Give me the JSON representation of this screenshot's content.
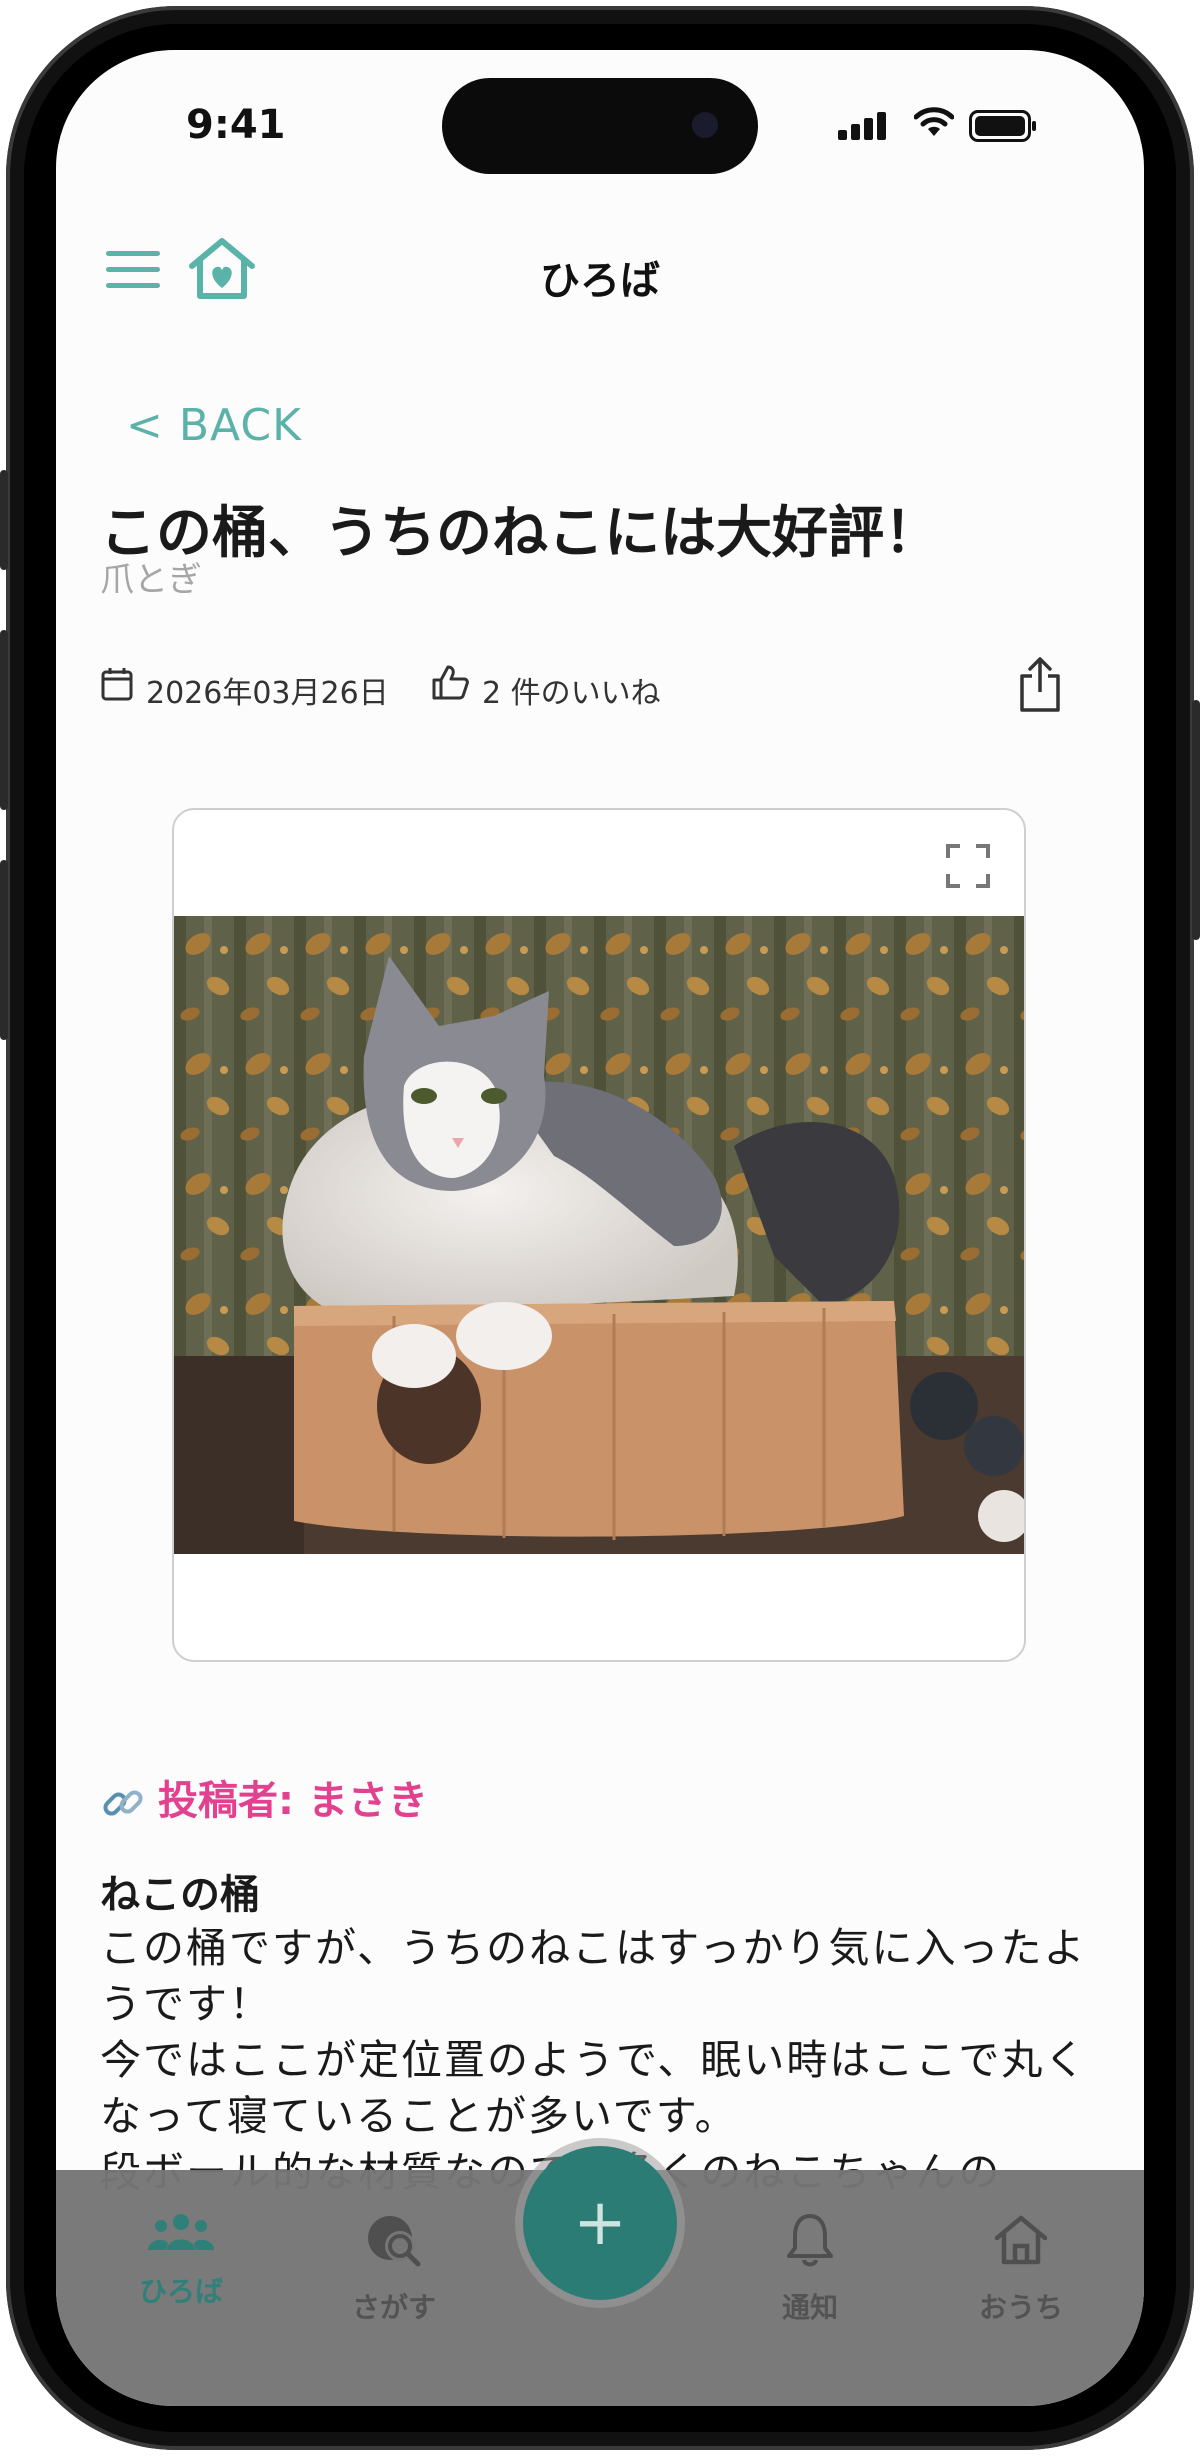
{
  "status_bar": {
    "time": "9:41"
  },
  "header": {
    "title": "ひろば"
  },
  "back_label": "< BACK",
  "post": {
    "title": "この桶、うちのねこには大好評！",
    "category": "爪とぎ",
    "date": "2026年03月26日",
    "likes": "2 件のいいね",
    "poster": "投稿者: まさき",
    "body_title": "ねこの桶",
    "body": "この桶ですが、うちのねこはすっかり気に入ったようです！\n今ではここが定位置のようで、眠い時はここで丸くなって寝ていることが多いです。\n段ボール的な材質なので、多くのねこちゃんの"
  },
  "tabs": [
    {
      "label": "ひろば",
      "icon": "group-icon",
      "active": true
    },
    {
      "label": "さがす",
      "icon": "search-globe-icon",
      "active": false
    },
    {
      "label": "通知",
      "icon": "bell-icon",
      "active": false
    },
    {
      "label": "おうち",
      "icon": "home-icon",
      "active": false
    }
  ],
  "fab_label": "+",
  "colors": {
    "accent": "#59b3a9",
    "poster": "#e2418f",
    "fab": "#2b7c74"
  }
}
